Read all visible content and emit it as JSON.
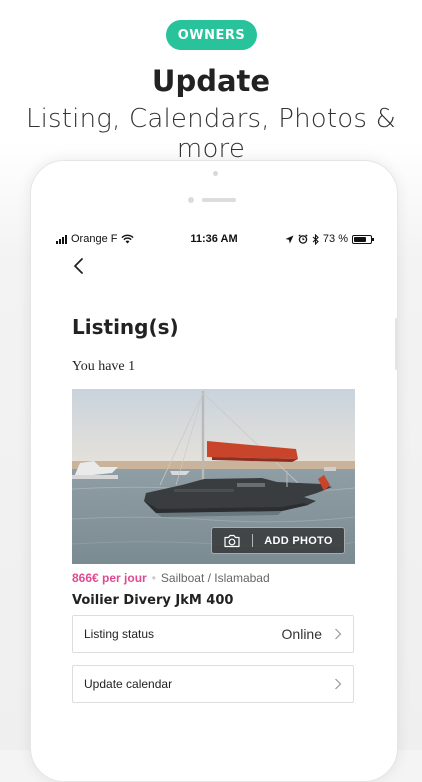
{
  "promo": {
    "badge": "OWNERS",
    "headline": "Update",
    "subline": "Listing, Calendars, Photos & more"
  },
  "status_bar": {
    "carrier": "Orange F",
    "time": "11:36 AM",
    "battery": "73 %",
    "battery_level": 0.73
  },
  "page": {
    "title": "Listing(s)",
    "count_text": "You have 1"
  },
  "listing": {
    "add_photo_label": "ADD PHOTO",
    "price": "866€ per jour",
    "separator": "•",
    "category": "Sailboat / Islamabad",
    "name": "Voilier Divery JkM 400"
  },
  "rows": {
    "status_label": "Listing status",
    "status_value": "Online",
    "calendar_label": "Update calendar"
  },
  "colors": {
    "accent_green": "#29c39b",
    "price_pink": "#e04a92"
  }
}
